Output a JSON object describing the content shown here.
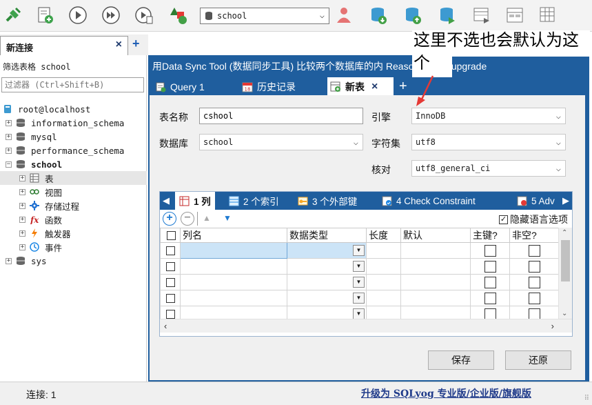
{
  "toolbar": {
    "db_select_value": "school",
    "icons": [
      "connect-icon",
      "new-query-icon",
      "run-icon",
      "run-all-icon",
      "run-to-file-icon",
      "shapes-icon",
      "user-icon",
      "db-download-icon",
      "db-upload-icon",
      "db-sync-icon",
      "schema-icon",
      "form-icon",
      "grid-icon"
    ]
  },
  "connection_tab": {
    "label": "新连接",
    "close": "×",
    "add": "+"
  },
  "left": {
    "filter_label": "筛选表格 school",
    "filter_placeholder": "过滤器 (Ctrl+Shift+B)",
    "tree": [
      {
        "label": "root@localhost",
        "level": 0,
        "icon": "server-icon"
      },
      {
        "label": "information_schema",
        "level": 1,
        "icon": "database-icon",
        "exp": "+"
      },
      {
        "label": "mysql",
        "level": 1,
        "icon": "database-icon",
        "exp": "+"
      },
      {
        "label": "performance_schema",
        "level": 1,
        "icon": "database-icon",
        "exp": "+"
      },
      {
        "label": "school",
        "level": 1,
        "icon": "database-icon",
        "exp": "−",
        "bold": true
      },
      {
        "label": "表",
        "level": 2,
        "icon": "table-icon",
        "exp": "+",
        "selected": true
      },
      {
        "label": "视图",
        "level": 2,
        "icon": "view-icon",
        "exp": "+"
      },
      {
        "label": "存储过程",
        "level": 2,
        "icon": "procedure-icon",
        "exp": "+"
      },
      {
        "label": "函数",
        "level": 2,
        "icon": "function-icon",
        "exp": "+"
      },
      {
        "label": "触发器",
        "level": 2,
        "icon": "trigger-icon",
        "exp": "+"
      },
      {
        "label": "事件",
        "level": 2,
        "icon": "event-icon",
        "exp": "+"
      },
      {
        "label": "sys",
        "level": 1,
        "icon": "database-icon",
        "exp": "+"
      }
    ]
  },
  "right": {
    "notice": "用Data Sync Tool (数据同步工具) 比较两个数据库的内 Reason #27 to upgrade",
    "tabs": [
      {
        "label": "Query 1"
      },
      {
        "label": "历史记录"
      },
      {
        "label": "新表",
        "close": "×"
      }
    ],
    "add_tab": "+"
  },
  "form": {
    "table_name_label": "表名称",
    "table_name_value": "cshool",
    "database_label": "数据库",
    "database_value": "school",
    "engine_label": "引擎",
    "engine_value": "InnoDB",
    "charset_label": "字符集",
    "charset_value": "utf8",
    "collation_label": "核对",
    "collation_value": "utf8_general_ci"
  },
  "grid": {
    "tabs": [
      {
        "label": "1 列"
      },
      {
        "label": "2 个索引"
      },
      {
        "label": "3 个外部键"
      },
      {
        "label": "4 Check Constraint"
      },
      {
        "label": "5 Adv"
      }
    ],
    "hide_lang_label": "隐藏语言选项",
    "hide_lang_checked": "✓",
    "headers": [
      "列名",
      "数据类型",
      "长度",
      "默认",
      "主键?",
      "非空?"
    ],
    "rows": 5
  },
  "buttons": {
    "save": "保存",
    "revert": "还原"
  },
  "annotation": "这里不选也会默认为这个",
  "status": {
    "connection": "连接: 1",
    "upgrade": "升级为 SQLyog 专业版/企业版/旗舰版"
  },
  "colors": {
    "accent": "#1f5e9e",
    "selection": "#cce4f7",
    "arrow": "#e53935"
  }
}
